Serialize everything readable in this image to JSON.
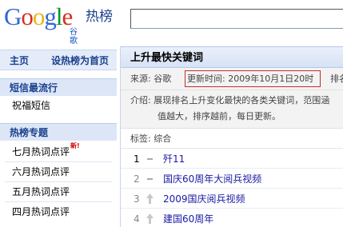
{
  "header": {
    "logo_text": "Google",
    "logo_sub": "谷歌",
    "product_name": "热榜",
    "search_value": ""
  },
  "sidebar": {
    "nav": [
      "主页",
      "设热榜为首页"
    ],
    "sections": [
      {
        "title": "短信最流行",
        "items": [
          "祝福短信"
        ]
      },
      {
        "title": "热榜专题",
        "items": [
          "七月热词点评",
          "六月热词点评",
          "五月热词点评",
          "四月热词点评"
        ],
        "badge": "新!"
      }
    ]
  },
  "panel": {
    "title": "上升最快关键词",
    "source_label": "来源: 谷歌",
    "update_label": "更新时间: 2009年10月1日20时",
    "rank_label": "排名",
    "intro_line1": "介绍: 展现排名上升变化最快的各类关键词，范围涵",
    "intro_line2": "值越大，排序越前，每日更新。",
    "tag_label": "标签: 综合",
    "rows": [
      {
        "rank": "1",
        "trend": "flat",
        "keyword": "歼11"
      },
      {
        "rank": "2",
        "trend": "flat",
        "keyword": "国庆60周年大阅兵视频"
      },
      {
        "rank": "3",
        "trend": "up",
        "keyword": "2009国庆阅兵视频"
      },
      {
        "rank": "4",
        "trend": "up",
        "keyword": "建国60周年"
      }
    ]
  },
  "colors": {
    "logo_blue": "#3367d6",
    "logo_red": "#d62d20",
    "logo_yellow": "#eeb211",
    "logo_green": "#009925",
    "link_blue": "#1a1aa6",
    "highlight_border": "#c0302b"
  }
}
